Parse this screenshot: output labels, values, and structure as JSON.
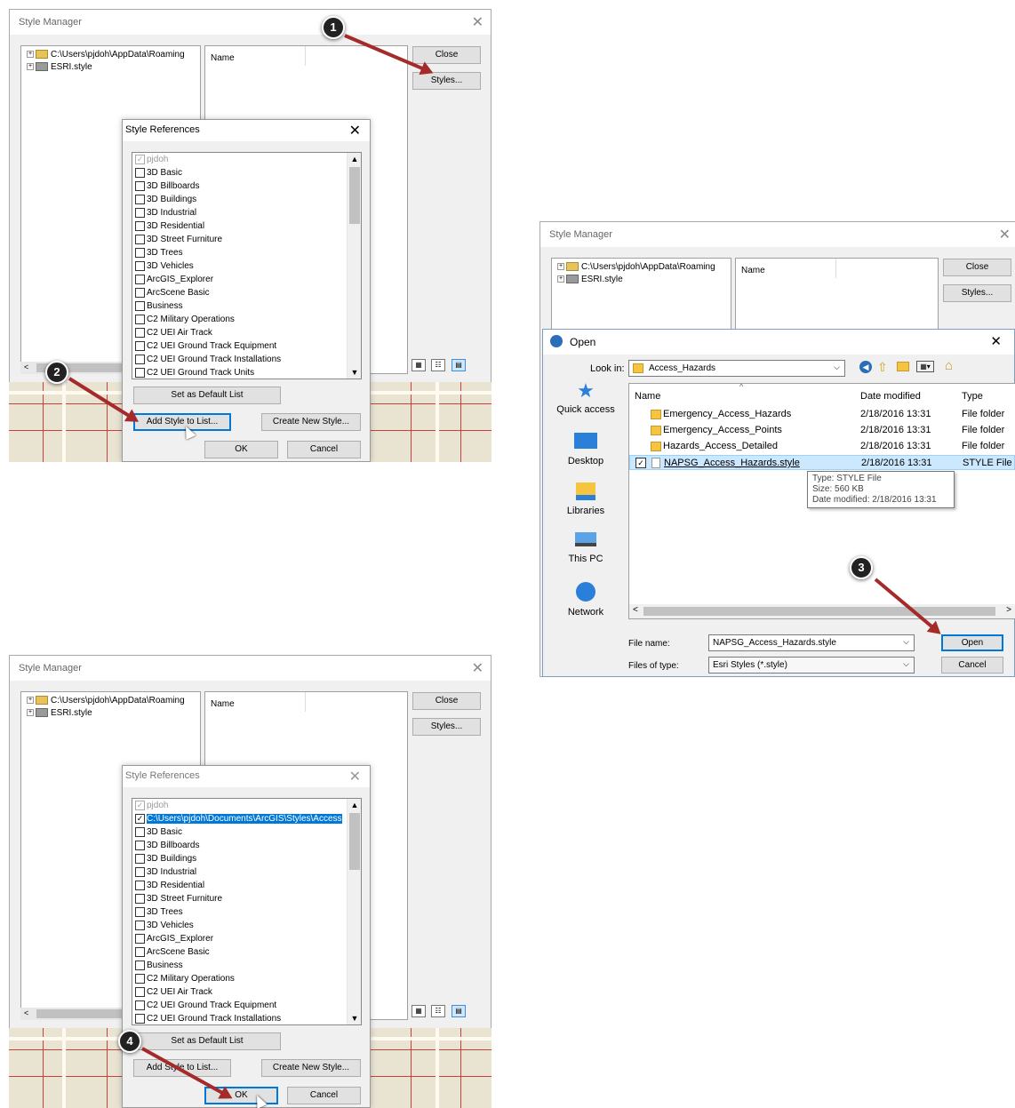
{
  "panel1": {
    "title": "Style Manager",
    "tree": [
      "C:\\Users\\pjdoh\\AppData\\Roaming",
      "ESRI.style"
    ],
    "name_header": "Name",
    "close": "Close",
    "styles": "Styles...",
    "dialog": {
      "title": "Style References",
      "items": [
        {
          "label": "pjdoh",
          "checked": true,
          "disabled": true
        },
        {
          "label": "3D Basic"
        },
        {
          "label": "3D Billboards"
        },
        {
          "label": "3D Buildings"
        },
        {
          "label": "3D Industrial"
        },
        {
          "label": "3D Residential"
        },
        {
          "label": "3D Street Furniture"
        },
        {
          "label": "3D Trees"
        },
        {
          "label": "3D Vehicles"
        },
        {
          "label": "ArcGIS_Explorer"
        },
        {
          "label": "ArcScene Basic"
        },
        {
          "label": "Business"
        },
        {
          "label": "C2 Military Operations"
        },
        {
          "label": "C2 UEI Air Track"
        },
        {
          "label": "C2 UEI Ground Track Equipment"
        },
        {
          "label": "C2 UEI Ground Track Installations"
        },
        {
          "label": "C2 UEI Ground Track Units"
        }
      ],
      "set_default": "Set as Default List",
      "add_style": "Add Style to List...",
      "create_new": "Create New Style...",
      "ok": "OK",
      "cancel": "Cancel"
    }
  },
  "panel2": {
    "title": "Style Manager",
    "tree": [
      "C:\\Users\\pjdoh\\AppData\\Roaming",
      "ESRI.style"
    ],
    "name_header": "Name",
    "close": "Close",
    "styles": "Styles...",
    "open": {
      "title": "Open",
      "look_in_label": "Look in:",
      "look_in_value": "Access_Hazards",
      "places": [
        "Quick access",
        "Desktop",
        "Libraries",
        "This PC",
        "Network"
      ],
      "columns": [
        "Name",
        "Date modified",
        "Type"
      ],
      "rows": [
        {
          "name": "Emergency_Access_Hazards",
          "date": "2/18/2016 13:31",
          "type": "File folder"
        },
        {
          "name": "Emergency_Access_Points",
          "date": "2/18/2016 13:31",
          "type": "File folder"
        },
        {
          "name": "Hazards_Access_Detailed",
          "date": "2/18/2016 13:31",
          "type": "File folder"
        },
        {
          "name": "NAPSG_Access_Hazards.style",
          "date": "2/18/2016 13:31",
          "type": "STYLE File"
        }
      ],
      "tooltip": [
        "Type: STYLE File",
        "Size: 560 KB",
        "Date modified: 2/18/2016 13:31"
      ],
      "file_name_label": "File name:",
      "file_name_value": "NAPSG_Access_Hazards.style",
      "file_type_label": "Files of type:",
      "file_type_value": "Esri Styles (*.style)",
      "open_btn": "Open",
      "cancel_btn": "Cancel"
    }
  },
  "panel3": {
    "title": "Style Manager",
    "tree": [
      "C:\\Users\\pjdoh\\AppData\\Roaming",
      "ESRI.style"
    ],
    "name_header": "Name",
    "close": "Close",
    "styles": "Styles...",
    "dialog": {
      "title": "Style References",
      "items": [
        {
          "label": "pjdoh",
          "checked": true,
          "disabled": true
        },
        {
          "label": "C:\\Users\\pjdoh\\Documents\\ArcGIS\\Styles\\Access",
          "checked": true,
          "selected": true
        },
        {
          "label": "3D Basic"
        },
        {
          "label": "3D Billboards"
        },
        {
          "label": "3D Buildings"
        },
        {
          "label": "3D Industrial"
        },
        {
          "label": "3D Residential"
        },
        {
          "label": "3D Street Furniture"
        },
        {
          "label": "3D Trees"
        },
        {
          "label": "3D Vehicles"
        },
        {
          "label": "ArcGIS_Explorer"
        },
        {
          "label": "ArcScene Basic"
        },
        {
          "label": "Business"
        },
        {
          "label": "C2 Military Operations"
        },
        {
          "label": "C2 UEI Air Track"
        },
        {
          "label": "C2 UEI Ground Track Equipment"
        },
        {
          "label": "C2 UEI Ground Track Installations"
        }
      ],
      "set_default": "Set as Default List",
      "add_style": "Add Style to List...",
      "create_new": "Create New Style...",
      "ok": "OK",
      "cancel": "Cancel"
    }
  },
  "steps": [
    "1",
    "2",
    "3",
    "4"
  ],
  "colors": {
    "arrow": "#a52a2a",
    "selection": "#0078d7",
    "badge": "#222222"
  }
}
